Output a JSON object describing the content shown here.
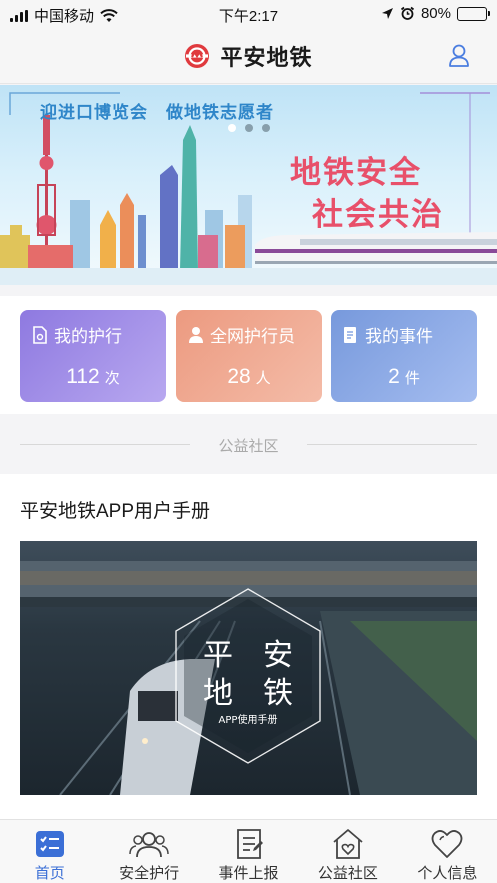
{
  "status_bar": {
    "carrier": "中国移动",
    "time": "下午2:17",
    "battery": "80%",
    "battery_level": 0.8
  },
  "navbar": {
    "title": "平安地铁",
    "logo_icon": "metro-logo-icon",
    "user_icon": "user-icon"
  },
  "banner": {
    "headline": "迎进口博览会　做地铁志愿者",
    "slogan_line1": "地铁安全",
    "slogan_line2": "社会共治",
    "slide_count": 3,
    "active_slide": 1
  },
  "stats": [
    {
      "label": "我的护行",
      "value": "112",
      "unit": "次",
      "icon": "document-icon"
    },
    {
      "label": "全网护行员",
      "value": "28",
      "unit": "人",
      "icon": "person-icon"
    },
    {
      "label": "我的事件",
      "value": "2",
      "unit": "件",
      "icon": "list-icon"
    }
  ],
  "section": {
    "title": "公益社区"
  },
  "article": {
    "title": "平安地铁APP用户手册",
    "image_text_line1": "平　安",
    "image_text_line2": "地　铁",
    "image_caption": "APP使用手册"
  },
  "tabbar": {
    "items": [
      {
        "label": "首页",
        "icon": "home-checklist-icon",
        "active": true
      },
      {
        "label": "安全护行",
        "icon": "group-icon",
        "active": false
      },
      {
        "label": "事件上报",
        "icon": "report-icon",
        "active": false
      },
      {
        "label": "公益社区",
        "icon": "community-icon",
        "active": false
      },
      {
        "label": "个人信息",
        "icon": "heart-icon",
        "active": false
      }
    ]
  },
  "colors": {
    "accent": "#3b6fd6",
    "brand_red": "#e03a3e",
    "slogan": "#e8506a"
  }
}
